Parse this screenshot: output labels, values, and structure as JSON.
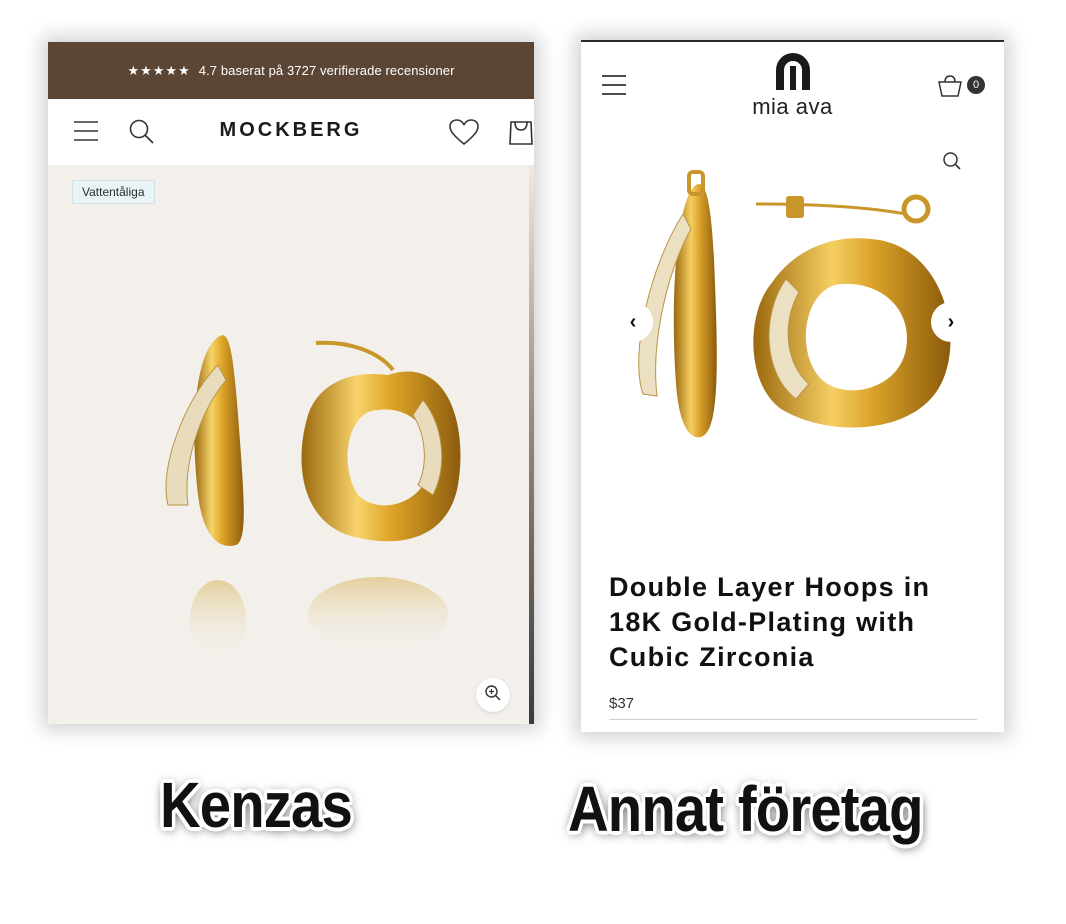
{
  "mockberg": {
    "promo": {
      "stars": "★★★★★",
      "text": "4.7 baserat på 3727 verifierade recensioner"
    },
    "logo": "MOCKBERG",
    "badge": "Vattentåliga",
    "icons": [
      "menu-icon",
      "search-icon",
      "heart-icon",
      "bag-icon",
      "zoom-icon"
    ],
    "colors": {
      "promo_bg": "#5b4535",
      "product_bg": "#f3f0eb",
      "gold": "#d9a92e"
    }
  },
  "miaava": {
    "logo": "mia ava",
    "cart_count": "0",
    "arrow_prev": "‹",
    "arrow_next": "›",
    "product_title": "Double Layer Hoops in 18K Gold-Plating with Cubic Zirconia",
    "price": "$37",
    "icons": [
      "menu-icon",
      "cart-icon",
      "search-icon"
    ]
  },
  "captions": {
    "left": "Kenzas",
    "right": "Annat företag"
  }
}
